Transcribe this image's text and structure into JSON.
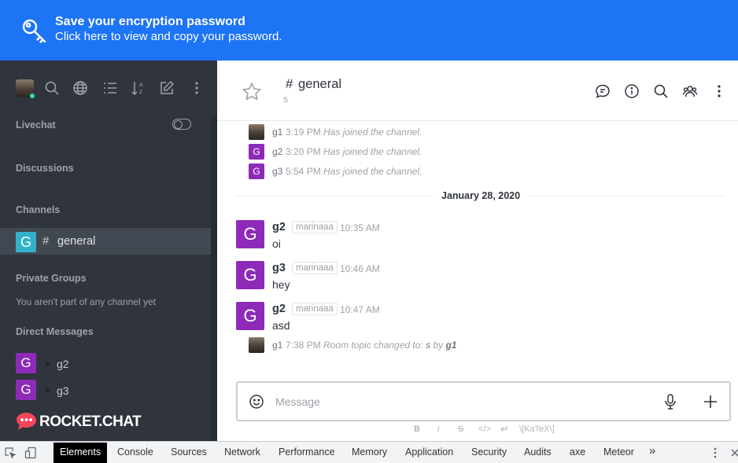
{
  "banner": {
    "title": "Save your encryption password",
    "subtitle": "Click here to view and copy your password."
  },
  "sidebar": {
    "toolbar_icons": [
      "user-avatar",
      "search-icon",
      "globe-icon",
      "list-icon",
      "sort-icon",
      "edit-icon",
      "kebab-icon"
    ],
    "livechat_label": "Livechat",
    "discussions_label": "Discussions",
    "channels_label": "Channels",
    "channels": [
      {
        "initial": "G",
        "hash": "#",
        "name": "general"
      }
    ],
    "private_groups_label": "Private Groups",
    "private_groups_empty": "You aren't part of any channel yet",
    "direct_messages_label": "Direct Messages",
    "direct_messages": [
      {
        "initial": "G",
        "name": "g2"
      },
      {
        "initial": "G",
        "name": "g3"
      }
    ],
    "logo_text": "ROCKET.CHAT",
    "colors": {
      "bg": "#2f343d",
      "selected": "#414852",
      "channel_avatar": "#32b1c9",
      "dm_avatar": "#8d2bb8"
    }
  },
  "room": {
    "hash": "#",
    "name": "general",
    "topic": "s",
    "header_icons": [
      "discussion-icon",
      "info-icon",
      "search-icon",
      "members-icon",
      "kebab-icon"
    ]
  },
  "system_messages": [
    {
      "user": "g1",
      "avatar": "photo",
      "time": "3:19 PM",
      "text": "Has joined the channel."
    },
    {
      "user": "g2",
      "avatar": "G",
      "time": "3:20 PM",
      "text": "Has joined the channel."
    },
    {
      "user": "g3",
      "avatar": "G",
      "time": "5:54 PM",
      "text": "Has joined the channel."
    }
  ],
  "date_divider": "January 28, 2020",
  "messages": [
    {
      "initial": "G",
      "user": "g2",
      "tag": "marinaaa",
      "time": "10:35 AM",
      "text": "oi"
    },
    {
      "initial": "G",
      "user": "g3",
      "tag": "marinaaa",
      "time": "10:46 AM",
      "text": "hey"
    },
    {
      "initial": "G",
      "user": "g2",
      "tag": "marinaaa",
      "time": "10:47 AM",
      "text": "asd"
    }
  ],
  "topic_change": {
    "user": "g1",
    "time": "7:38 PM",
    "prefix": "Room topic changed to:",
    "value": "s",
    "by": "by",
    "by_user": "g1"
  },
  "composer": {
    "placeholder": "Message",
    "formatting": [
      "B",
      "i",
      "S",
      "</>",
      "↵",
      "\\[KaTeX\\]"
    ]
  },
  "devtools": {
    "tabs": [
      "Elements",
      "Console",
      "Sources",
      "Network",
      "Performance",
      "Memory",
      "Application",
      "Security",
      "Audits",
      "axe",
      "Meteor"
    ],
    "active_tab": "Elements",
    "more": "»"
  }
}
